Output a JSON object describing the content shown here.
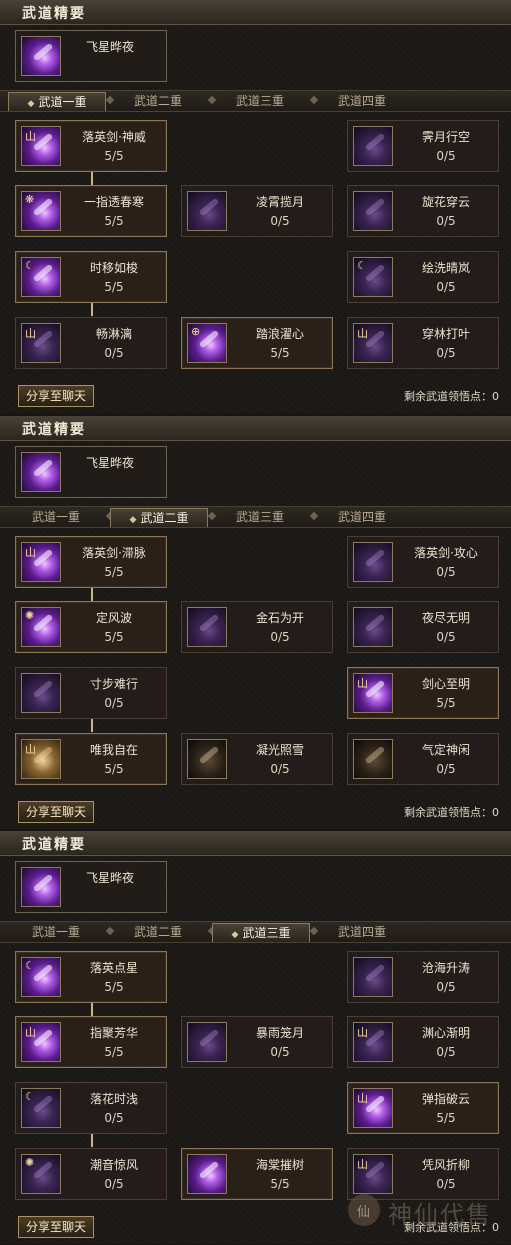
{
  "panels": [
    {
      "header": "武道精要",
      "essence": {
        "name": "飞星晔夜"
      },
      "tabs": [
        "武道一重",
        "武道二重",
        "武道三重",
        "武道四重"
      ],
      "active_tab": 0,
      "nodes": [
        {
          "name": "落英剑·神威",
          "points": "5/5",
          "lit": true,
          "icon": "on",
          "glyph": "山"
        },
        {
          "name": "霁月行空",
          "points": "0/5",
          "lit": false,
          "icon": "off",
          "glyph": ""
        },
        {
          "name": "一指透春寒",
          "points": "5/5",
          "lit": true,
          "icon": "on",
          "glyph": "❋"
        },
        {
          "name": "凌霄揽月",
          "points": "0/5",
          "lit": false,
          "icon": "off",
          "glyph": ""
        },
        {
          "name": "旋花穿云",
          "points": "0/5",
          "lit": false,
          "icon": "off",
          "glyph": ""
        },
        {
          "name": "时移如梭",
          "points": "5/5",
          "lit": true,
          "icon": "on",
          "glyph": "☾"
        },
        {
          "name": "绘洗晴岚",
          "points": "0/5",
          "lit": false,
          "icon": "off",
          "glyph": "☾"
        },
        {
          "name": "畅淋漓",
          "points": "0/5",
          "lit": false,
          "icon": "off",
          "glyph": "山"
        },
        {
          "name": "踏浪濯心",
          "points": "5/5",
          "lit": true,
          "icon": "on",
          "glyph": "⊕"
        },
        {
          "name": "穿林打叶",
          "points": "0/5",
          "lit": false,
          "icon": "off",
          "glyph": "山"
        }
      ],
      "share_label": "分享至聊天",
      "remain_label": "剩余武道领悟点：",
      "remain_value": "0"
    },
    {
      "header": "武道精要",
      "essence": {
        "name": "飞星晔夜"
      },
      "tabs": [
        "武道一重",
        "武道二重",
        "武道三重",
        "武道四重"
      ],
      "active_tab": 1,
      "nodes": [
        {
          "name": "落英剑·滞脉",
          "points": "5/5",
          "lit": true,
          "icon": "on",
          "glyph": "山"
        },
        {
          "name": "落英剑·攻心",
          "points": "0/5",
          "lit": false,
          "icon": "off",
          "glyph": ""
        },
        {
          "name": "定风波",
          "points": "5/5",
          "lit": true,
          "icon": "on",
          "glyph": "✺"
        },
        {
          "name": "金石为开",
          "points": "0/5",
          "lit": false,
          "icon": "off",
          "glyph": ""
        },
        {
          "name": "夜尽无明",
          "points": "0/5",
          "lit": false,
          "icon": "off",
          "glyph": ""
        },
        {
          "name": "寸步难行",
          "points": "0/5",
          "lit": false,
          "icon": "off",
          "glyph": ""
        },
        {
          "name": "剑心至明",
          "points": "5/5",
          "lit": true,
          "icon": "on",
          "glyph": "山"
        },
        {
          "name": "唯我自在",
          "points": "5/5",
          "lit": true,
          "icon": "gold",
          "glyph": "山"
        },
        {
          "name": "凝光照雪",
          "points": "0/5",
          "lit": false,
          "icon": "dark",
          "glyph": ""
        },
        {
          "name": "气定神闲",
          "points": "0/5",
          "lit": false,
          "icon": "dark",
          "glyph": ""
        }
      ],
      "share_label": "分享至聊天",
      "remain_label": "剩余武道领悟点：",
      "remain_value": "0"
    },
    {
      "header": "武道精要",
      "essence": {
        "name": "飞星晔夜"
      },
      "tabs": [
        "武道一重",
        "武道二重",
        "武道三重",
        "武道四重"
      ],
      "active_tab": 2,
      "nodes": [
        {
          "name": "落英点星",
          "points": "5/5",
          "lit": true,
          "icon": "on",
          "glyph": "☾"
        },
        {
          "name": "沧海升涛",
          "points": "0/5",
          "lit": false,
          "icon": "off",
          "glyph": ""
        },
        {
          "name": "指聚芳华",
          "points": "5/5",
          "lit": true,
          "icon": "on",
          "glyph": "山"
        },
        {
          "name": "暴雨笼月",
          "points": "0/5",
          "lit": false,
          "icon": "off",
          "glyph": ""
        },
        {
          "name": "渊心渐明",
          "points": "0/5",
          "lit": false,
          "icon": "off",
          "glyph": "山"
        },
        {
          "name": "落花时浅",
          "points": "0/5",
          "lit": false,
          "icon": "off",
          "glyph": "☾"
        },
        {
          "name": "弹指破云",
          "points": "5/5",
          "lit": true,
          "icon": "on",
          "glyph": "山"
        },
        {
          "name": "潮音惊风",
          "points": "0/5",
          "lit": false,
          "icon": "off",
          "glyph": "✺"
        },
        {
          "name": "海棠摧树",
          "points": "5/5",
          "lit": true,
          "icon": "on",
          "glyph": ""
        },
        {
          "name": "凭风折柳",
          "points": "0/5",
          "lit": false,
          "icon": "off",
          "glyph": "山"
        }
      ],
      "share_label": "分享至聊天",
      "remain_label": "剩余武道领悟点：",
      "remain_value": "0"
    }
  ],
  "watermark": {
    "text": "神仙代售",
    "logo": "仙"
  }
}
